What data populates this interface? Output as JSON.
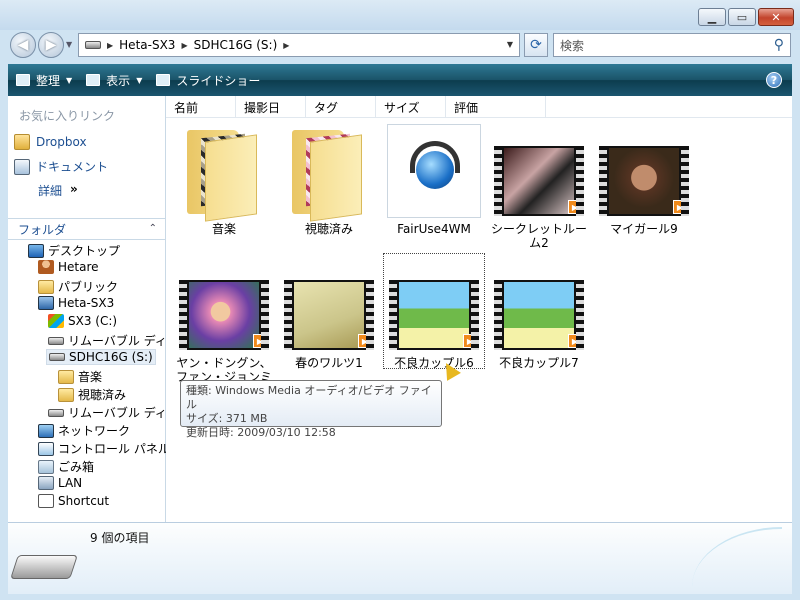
{
  "window": {
    "minimize_icon": "minimize-icon",
    "maximize_icon": "maximize-icon",
    "close_icon": "close-icon"
  },
  "address_bar": {
    "crumbs": [
      "Heta-SX3",
      "SDHC16G (S:)"
    ]
  },
  "search": {
    "placeholder": "検索"
  },
  "toolbar": {
    "organize": "整理",
    "view": "表示",
    "slideshow": "スライドショー"
  },
  "nav": {
    "favorites_title": "お気に入りリンク",
    "favorites": [
      "Dropbox",
      "ドキュメント"
    ],
    "more": "詳細",
    "more_arrow": "»",
    "folders_title": "フォルダ",
    "tree": [
      "デスクトップ",
      "Hetare",
      "パブリック",
      "Heta-SX3",
      "SX3 (C:)",
      "リムーバブル ディ",
      "SDHC16G (S:)",
      "音楽",
      "視聴済み",
      "リムーバブル ディ",
      "ネットワーク",
      "コントロール パネル",
      "ごみ箱",
      "LAN",
      "Shortcut"
    ]
  },
  "columns": [
    "名前",
    "撮影日",
    "タグ",
    "サイズ",
    "評価"
  ],
  "items": [
    "音楽",
    "視聴済み",
    "FairUse4WM",
    "シークレットルーム2",
    "マイガール9",
    "ヤン・ドングン、ファン・ジョンミン、ソン...",
    "春のワルツ1",
    "不良カップル6",
    "不良カップル7"
  ],
  "tooltip": {
    "type": "種類: Windows Media オーディオ/ビデオ ファイル",
    "size": "サイズ: 371 MB",
    "modified": "更新日時: 2009/03/10 12:58"
  },
  "details": {
    "count": "9 個の項目"
  },
  "colors": {
    "toolbar": "#1a5368",
    "link": "#1d4f91"
  }
}
